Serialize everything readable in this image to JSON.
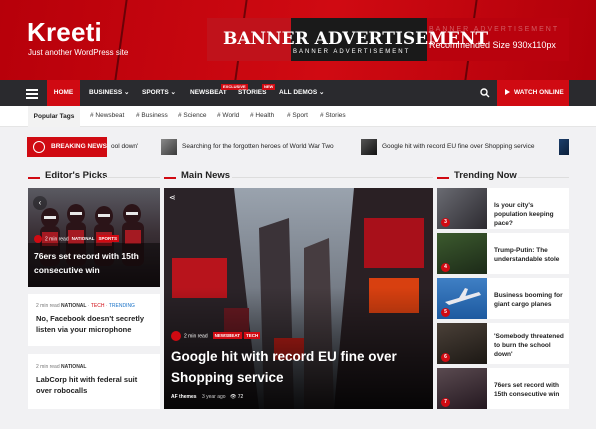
{
  "site": {
    "logo": "Kreeti",
    "tagline": "Just another WordPress site"
  },
  "banner": {
    "title": "BANNER ADVERTISEMENT",
    "subtitle": "BANNER ADVERTISEMENT",
    "ghost": "BANNER ADVERTISEMENT",
    "size": "Recommended Size 930x110px"
  },
  "nav": {
    "items": [
      {
        "label": "HOME"
      },
      {
        "label": "BUSINESS ⌄"
      },
      {
        "label": "SPORTS ⌄"
      },
      {
        "label": "NEWSBEAT",
        "badge": "EXCLUSIVE"
      },
      {
        "label": "STORIES",
        "badge": "NEW"
      },
      {
        "label": "ALL DEMOS ⌄"
      }
    ],
    "watch_label": "WATCH ONLINE"
  },
  "tags": {
    "label": "Popular Tags",
    "items": [
      "# Newsbeat",
      "# Business",
      "# Science",
      "# World",
      "# Health",
      "# Sport",
      "# Stories"
    ]
  },
  "ticker": {
    "label": "BREAKING NEWS",
    "items": [
      "ool down'",
      "Searching for the forgotten heroes of World War Two",
      "Google hit with record EU fine over Shopping service"
    ]
  },
  "sections": {
    "editors": "Editor's Picks",
    "main": "Main News",
    "trending": "Trending Now"
  },
  "editors": {
    "featured": {
      "read": "2 min read",
      "cats": [
        "NATIONAL",
        "SPORTS"
      ],
      "title": "76ers set record with 15th consecutive win"
    },
    "list": [
      {
        "read": "2 min read",
        "cats": [
          "NATIONAL",
          "TECH",
          "TRENDING"
        ],
        "title": "No, Facebook doesn't secretly listen via your microphone"
      },
      {
        "read": "2 min read",
        "cats": [
          "NATIONAL"
        ],
        "title": "LabCorp hit with federal suit over robocalls"
      }
    ]
  },
  "main_news": {
    "read": "2 min read",
    "cats": [
      "NEWSBEAT",
      "TECH"
    ],
    "title": "Google hit with record EU fine over Shopping service",
    "author": "AF themes",
    "ago": "3 year ago",
    "views": "72"
  },
  "trending": [
    {
      "num": "3",
      "title": "Is your city's population keeping pace?"
    },
    {
      "num": "4",
      "title": "Trump-Putin: The understandable stole"
    },
    {
      "num": "5",
      "title": "Business booming for giant cargo planes"
    },
    {
      "num": "6",
      "title": "'Somebody threatened to burn the school down'"
    },
    {
      "num": "7",
      "title": "76ers set record with 15th consecutive win"
    }
  ],
  "colors": {
    "brand_red": "#d00a12",
    "nav_dark": "#2a2a2e",
    "background": "#f1f1f3"
  }
}
